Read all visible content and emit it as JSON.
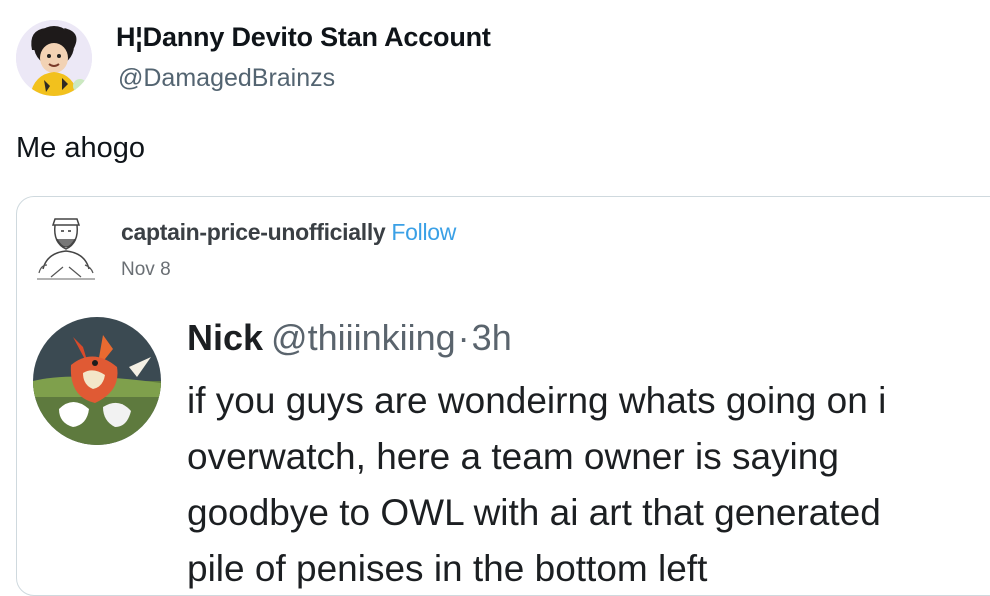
{
  "tweet": {
    "author_name": "H¦Danny Devito Stan Account",
    "author_handle": "@DamagedBrainzs",
    "text": "Me ahogo"
  },
  "quote": {
    "author": "captain-price-unofficially",
    "follow_label": "Follow",
    "date": "Nov 8",
    "inner_tweet": {
      "name": "Nick",
      "handle": "@thiiinkiing",
      "separator": "·",
      "time": "3h",
      "lines": [
        "if you guys are wondeirng whats going on i",
        "overwatch, here a team owner is saying",
        "goodbye to OWL with ai art that generated",
        "pile of penises in the bottom left"
      ]
    }
  },
  "colors": {
    "handle": "#536471",
    "follow": "#3aa0e6",
    "border": "#cfd9de"
  }
}
